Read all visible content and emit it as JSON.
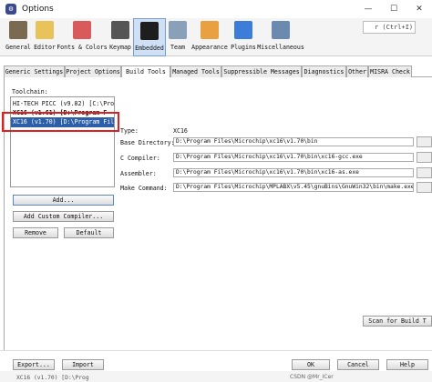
{
  "window": {
    "title": "Options",
    "minimize": "—",
    "maximize": "☐",
    "close": "✕"
  },
  "search": {
    "placeholder": "r (Ctrl+I)"
  },
  "categories": [
    {
      "label": "General",
      "icon": "general-settings-icon",
      "color": "#7b6a52"
    },
    {
      "label": "Editor",
      "icon": "editor-icon",
      "color": "#e8c35a"
    },
    {
      "label": "Fonts & Colors",
      "icon": "fonts-colors-icon",
      "color": "#d85a5a"
    },
    {
      "label": "Keymap",
      "icon": "keymap-icon",
      "color": "#555555"
    },
    {
      "label": "Embedded",
      "icon": "embedded-chip-icon",
      "color": "#1e1e1e"
    },
    {
      "label": "Team",
      "icon": "team-icon",
      "color": "#8aa0b8"
    },
    {
      "label": "Appearance",
      "icon": "appearance-icon",
      "color": "#e8a040"
    },
    {
      "label": "Plugins",
      "icon": "plugins-icon",
      "color": "#3b7dd8"
    },
    {
      "label": "Miscellaneous",
      "icon": "miscellaneous-icon",
      "color": "#6a8ab0"
    }
  ],
  "tabs": [
    "Generic Settings",
    "Project Options",
    "Build Tools",
    "Managed Tools",
    "Suppressible Messages",
    "Diagnostics",
    "Other",
    "MISRA Check"
  ],
  "active_tab": "Build Tools",
  "toolchain": {
    "label": "Toolchain:",
    "items": [
      "HI-TECH PICC (v9.82) [C:\\Progr",
      "XC16 (v1.61) [D:\\Program F",
      "XC16 (v1.70) [D:\\Program Files"
    ],
    "selected_index": 2
  },
  "buttons": {
    "add": "Add...",
    "add_custom": "Add Custom Compiler...",
    "remove": "Remove",
    "default": "Default",
    "scan": "Scan for Build T",
    "export": "Export...",
    "import": "Import",
    "ok": "OK",
    "cancel": "Cancel",
    "help": "Help"
  },
  "details": {
    "type_label": "Type:",
    "type_value": "XC16",
    "base_dir_label": "Base Directory:",
    "base_dir_value": "D:\\Program Files\\Microchip\\xc16\\v1.70\\bin",
    "c_compiler_label": "C Compiler:",
    "c_compiler_value": "D:\\Program Files\\Microchip\\xc16\\v1.70\\bin\\xc16-gcc.exe",
    "assembler_label": "Assembler:",
    "assembler_value": "D:\\Program Files\\Microchip\\xc16\\v1.70\\bin\\xc16-as.exe",
    "make_label": "Make Command:",
    "make_value": "D:\\Program Files\\Microchip\\MPLABX\\v5.45\\gnuBins\\GnuWin32\\bin\\make.exe"
  },
  "footer": {
    "watermark": "CSDN @Mr_ICer",
    "behind_text": "XC16 (v1.70) [D:\\Prog"
  }
}
